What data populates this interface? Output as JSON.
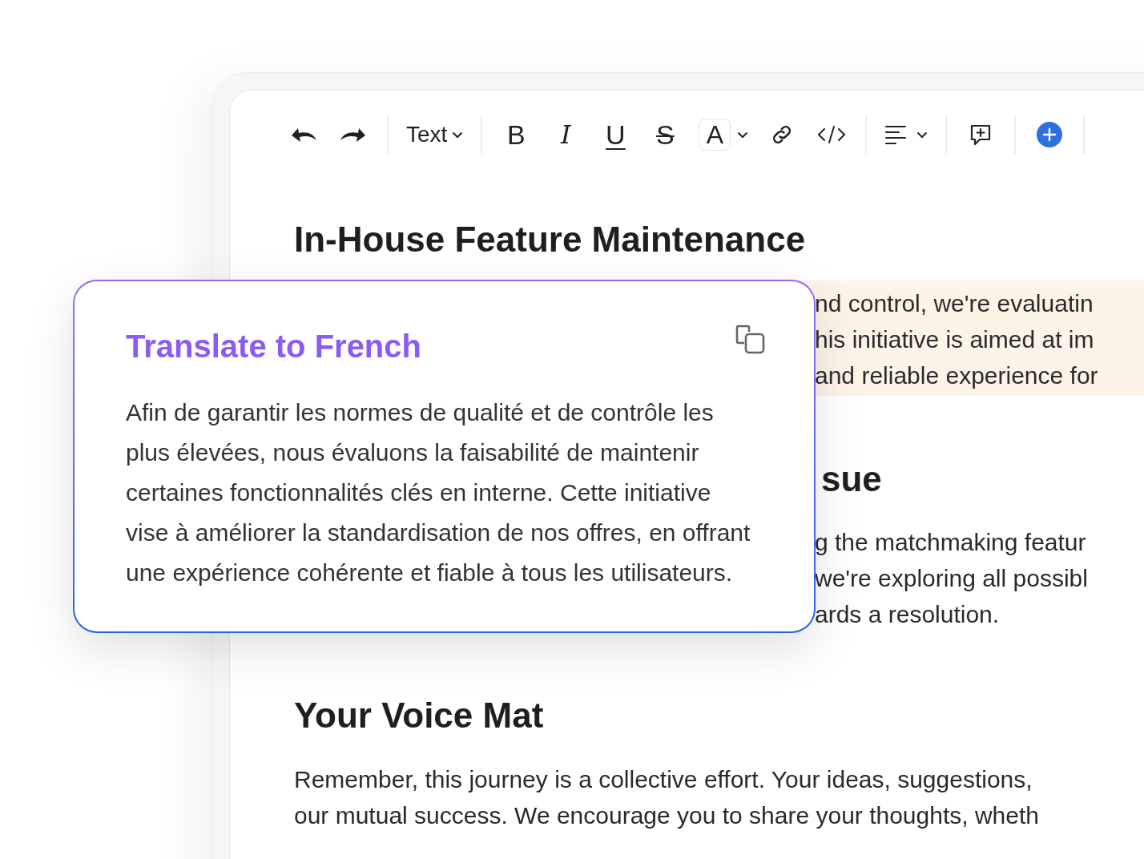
{
  "toolbar": [
    {
      "kind": "undo"
    },
    {
      "kind": "redo"
    },
    {
      "kind": "separator"
    },
    {
      "kind": "block-type",
      "label": "Text"
    },
    {
      "kind": "separator"
    },
    {
      "kind": "bold",
      "label": "B"
    },
    {
      "kind": "italic",
      "label": "I"
    },
    {
      "kind": "underline",
      "label": "U"
    },
    {
      "kind": "strike",
      "label": "S"
    },
    {
      "kind": "text-color",
      "label": "A"
    },
    {
      "kind": "link"
    },
    {
      "kind": "code"
    },
    {
      "kind": "separator"
    },
    {
      "kind": "align"
    },
    {
      "kind": "separator"
    },
    {
      "kind": "comment"
    },
    {
      "kind": "separator"
    },
    {
      "kind": "insert"
    },
    {
      "kind": "separator"
    }
  ],
  "document": [
    {
      "kind": "heading",
      "text": "In-House Feature Maintenance"
    },
    {
      "kind": "paragraph",
      "highlighted": true,
      "lines": [
        "nd control, we're evaluatin",
        "his initiative is aimed at im",
        "and reliable experience for"
      ]
    },
    {
      "kind": "heading",
      "text": "sue"
    },
    {
      "kind": "paragraph",
      "highlighted": false,
      "lines": [
        "g the matchmaking featur",
        "we're exploring all possibl",
        "ards a resolution."
      ]
    },
    {
      "kind": "heading",
      "text": "Your Voice Mat"
    },
    {
      "kind": "paragraph",
      "highlighted": false,
      "lines": [
        "Remember, this journey is a collective effort. Your ideas, suggestions,",
        "our mutual success. We encourage you to share your thoughts, wheth"
      ]
    }
  ],
  "translation_popup": {
    "title": "Translate to French",
    "text": "Afin de garantir les normes de qualité et de contrôle les plus élevées, nous évaluons la faisabilité de maintenir certaines fonctionnalités clés en interne. Cette initiative vise à améliorer la standardisation de nos offres, en offrant une expérience cohérente et fiable à tous les utilisateurs."
  }
}
